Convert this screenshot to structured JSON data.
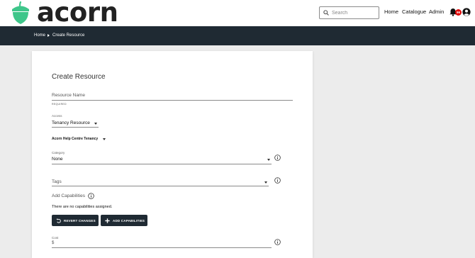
{
  "header": {
    "logo_text": "acorn",
    "logo_icon": "acorn-icon",
    "search_placeholder": "Search",
    "nav": [
      "Home",
      "Catalogue",
      "Admin"
    ],
    "notification_count": "99",
    "brand_color": "#3ec68a"
  },
  "breadcrumb": {
    "items": [
      "Home",
      "Create Resource"
    ]
  },
  "form": {
    "title": "Create Resource",
    "resource_name": {
      "label": "Resource Name",
      "value": "",
      "hint": "REQUIRED"
    },
    "access": {
      "label": "Access",
      "value": "Tenancy Resource"
    },
    "tenancy": {
      "value": "Acorn Help Centre Tenancy"
    },
    "category": {
      "label": "Category",
      "value": "None"
    },
    "tags": {
      "label": "Tags",
      "value": ""
    },
    "capabilities": {
      "label": "Add Capabilities",
      "empty_text": "There are no capabilities assigned.",
      "revert_label": "REVERT CHANGES",
      "add_label": "ADD CAPABILITIES"
    },
    "cost": {
      "label": "Cost",
      "prefix": "$"
    }
  },
  "colors": {
    "dark_bar": "#1f2a33",
    "badge": "#e00000"
  }
}
